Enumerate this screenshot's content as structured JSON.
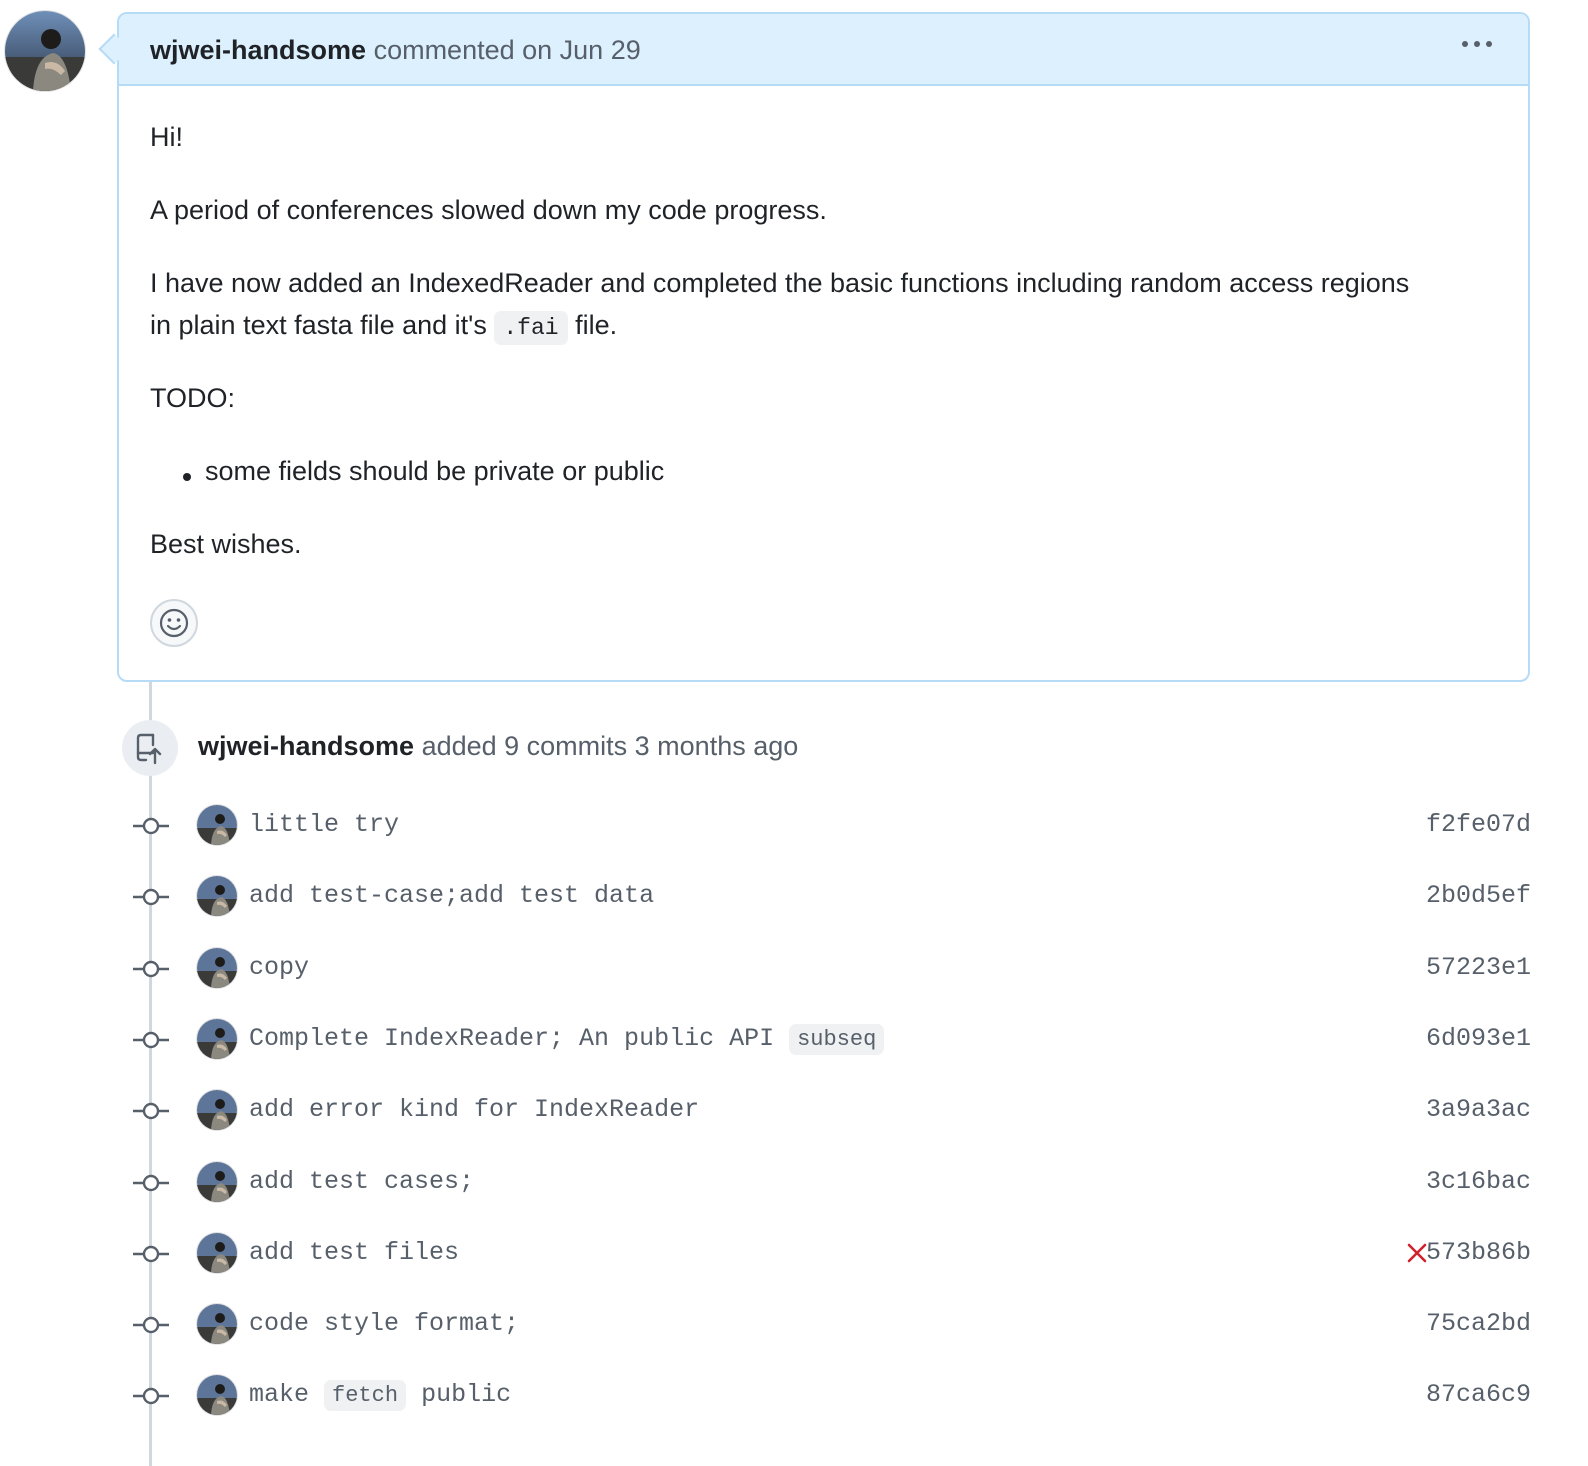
{
  "comment": {
    "author": "wjwei-handsome",
    "action": "commented on Jun 29",
    "greeting": "Hi!",
    "para1": "A period of conferences slowed down my code progress.",
    "para2_line1": "I have now added an IndexedReader and completed the basic functions including random access regions",
    "para2_line2_pre": "in plain text fasta file and it's",
    "para2_code": ".fai",
    "para2_line2_post": "file.",
    "todo_heading": "TODO:",
    "todo_items": [
      "some fields should be private or public"
    ],
    "closing": "Best wishes."
  },
  "event": {
    "author": "wjwei-handsome",
    "text": "added 9 commits 3 months ago"
  },
  "commits": [
    {
      "message": "little try",
      "sha": "f2fe07d"
    },
    {
      "message": "add test-case;add test data",
      "sha": "2b0d5ef"
    },
    {
      "message": "copy",
      "sha": "57223e1"
    },
    {
      "message_pre": "Complete IndexReader; An public API",
      "message_tag": "subseq",
      "message_post": "",
      "sha": "6d093e1"
    },
    {
      "message": "add error kind for IndexReader",
      "sha": "3a9a3ac"
    },
    {
      "message": "add test cases;",
      "sha": "3c16bac"
    },
    {
      "message": "add test files",
      "sha": "573b86b",
      "status": "failed"
    },
    {
      "message": "code style format;",
      "sha": "75ca2bd"
    },
    {
      "message_pre": "make",
      "message_tag": "fetch",
      "message_post": "public",
      "sha": "87ca6c9"
    }
  ],
  "icons": {
    "more": "kebab-horizontal-icon",
    "reaction": "smiley-icon",
    "push": "repo-push-icon",
    "commit": "git-commit-icon",
    "fail": "x-icon"
  },
  "colors": {
    "header_bg": "#ddf0fd",
    "border": "#b6dbf7",
    "muted": "#57606a",
    "fail": "#cf222e"
  }
}
